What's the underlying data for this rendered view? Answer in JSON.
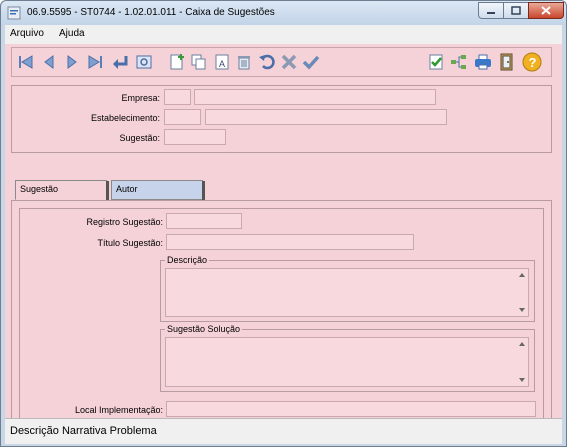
{
  "window": {
    "title": "06.9.5595 - ST0744 - 1.02.01.011 - Caixa de Sugestões"
  },
  "menu": {
    "items": [
      {
        "label": "Arquivo"
      },
      {
        "label": "Ajuda"
      }
    ]
  },
  "toolbar": {
    "left_icons": [
      "first-record-icon",
      "previous-record-icon",
      "next-record-icon",
      "last-record-icon",
      "enter-icon",
      "preview-icon"
    ],
    "edit_icons": [
      "new-icon",
      "copy-icon",
      "rename-icon",
      "delete-icon",
      "undo-icon",
      "cancel-icon",
      "confirm-icon"
    ],
    "right_icons": [
      "checklist-icon",
      "tree-icon",
      "print-icon",
      "exit-door-icon",
      "help-icon"
    ]
  },
  "header_form": {
    "empresa_label": "Empresa:",
    "estabelecimento_label": "Estabelecimento:",
    "sugestao_label": "Sugestão:"
  },
  "tabs": [
    {
      "label": "Sugestão",
      "active": true
    },
    {
      "label": "Autor",
      "active": false
    }
  ],
  "detail_form": {
    "registro_label": "Registro Sugestão:",
    "titulo_label": "Título Sugestão:",
    "descricao_legend": "Descrição",
    "solucao_legend": "Sugestão Solução",
    "local_label": "Local Implementação:"
  },
  "status": {
    "text": "Descrição Narrativa Problema"
  },
  "colors": {
    "form_background": "#f5d2d8",
    "field_background": "#f7d9de",
    "inactive_tab": "#c7d3ea"
  }
}
